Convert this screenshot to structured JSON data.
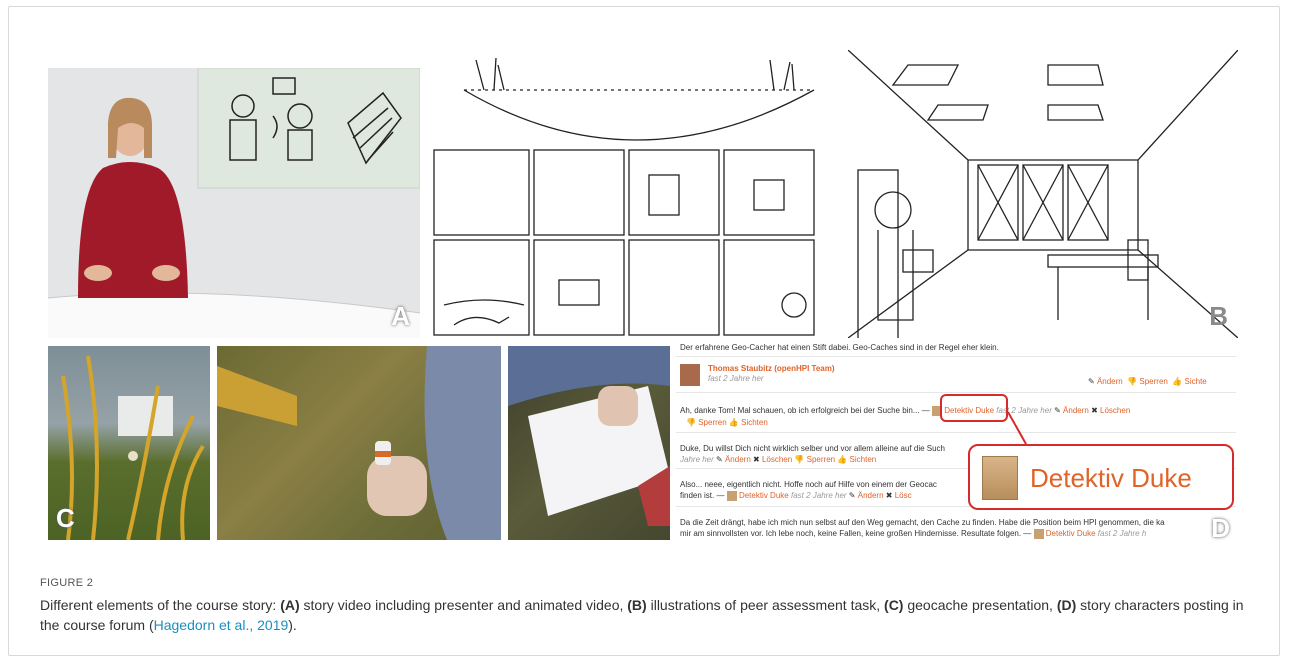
{
  "figure": {
    "label": "FIGURE 2",
    "caption": {
      "intro": "Different elements of the course story: ",
      "a_tag": "(A)",
      "a_text": " story video including presenter and animated video, ",
      "b_tag": "(B)",
      "b_text": " illustrations of peer assessment task, ",
      "c_tag": "(C)",
      "c_text": " geocache presentation, ",
      "d_tag": "(D)",
      "d_text": " story characters posting in the course forum (",
      "citation": "Hagedorn et al., 2019",
      "end": ")."
    }
  },
  "panels": {
    "a": "A",
    "b": "B",
    "c": "C",
    "d": "D"
  },
  "forum": {
    "line1": "Der erfahrene Geo-Cacher hat einen Stift dabei. Geo-Caches sind in der Regel eher klein.",
    "author": "Thomas Staubitz (openHPI Team)",
    "author_time": "fast 2 Jahre her",
    "action_edit": "Ändern",
    "action_lock": "Sperren",
    "action_view": "Sichte",
    "reply1": "Ah, danke Tom! Mal schauen, ob ich erfolgreich bei der Suche bin... —",
    "reply1_author": "Detektiv Duke",
    "reply1_time": "fast 2 Jahre her",
    "reply1_edit": "Ändern",
    "reply1_delete": "Löschen",
    "reply1_lock": "Sperren",
    "reply1_view": "Sichten",
    "reply2": "Duke, Du willst Dich nicht wirklich selber und vor allem alleine auf die Such",
    "reply2_time": "Jahre her",
    "reply2_edit": "Ändern",
    "reply2_delete": "Löschen",
    "reply2_lock": "Sperren",
    "reply2_view": "Sichten",
    "reply3": "Also... neee, eigentlich nicht. Hoffe noch auf Hilfe von einem der Geocac",
    "reply3b": "finden ist. —",
    "reply3_author": "Detektiv Duke",
    "reply3_time": "fast 2 Jahre her",
    "reply3_edit": "Ändern",
    "reply3_delete": "Lösc",
    "reply4": "Da die Zeit drängt, habe ich mich nun selbst auf den Weg gemacht, den Cache zu finden. Habe die Position beim HPI genommen, die ka",
    "reply4b": "mir am sinnvollsten vor. Ich lebe noch, keine Fallen, keine großen Hindernisse. Resultate folgen. —",
    "reply4_author": "Detektiv Duke",
    "reply4_time": "fast 2 Jahre h",
    "callout": "Detektiv Duke"
  }
}
